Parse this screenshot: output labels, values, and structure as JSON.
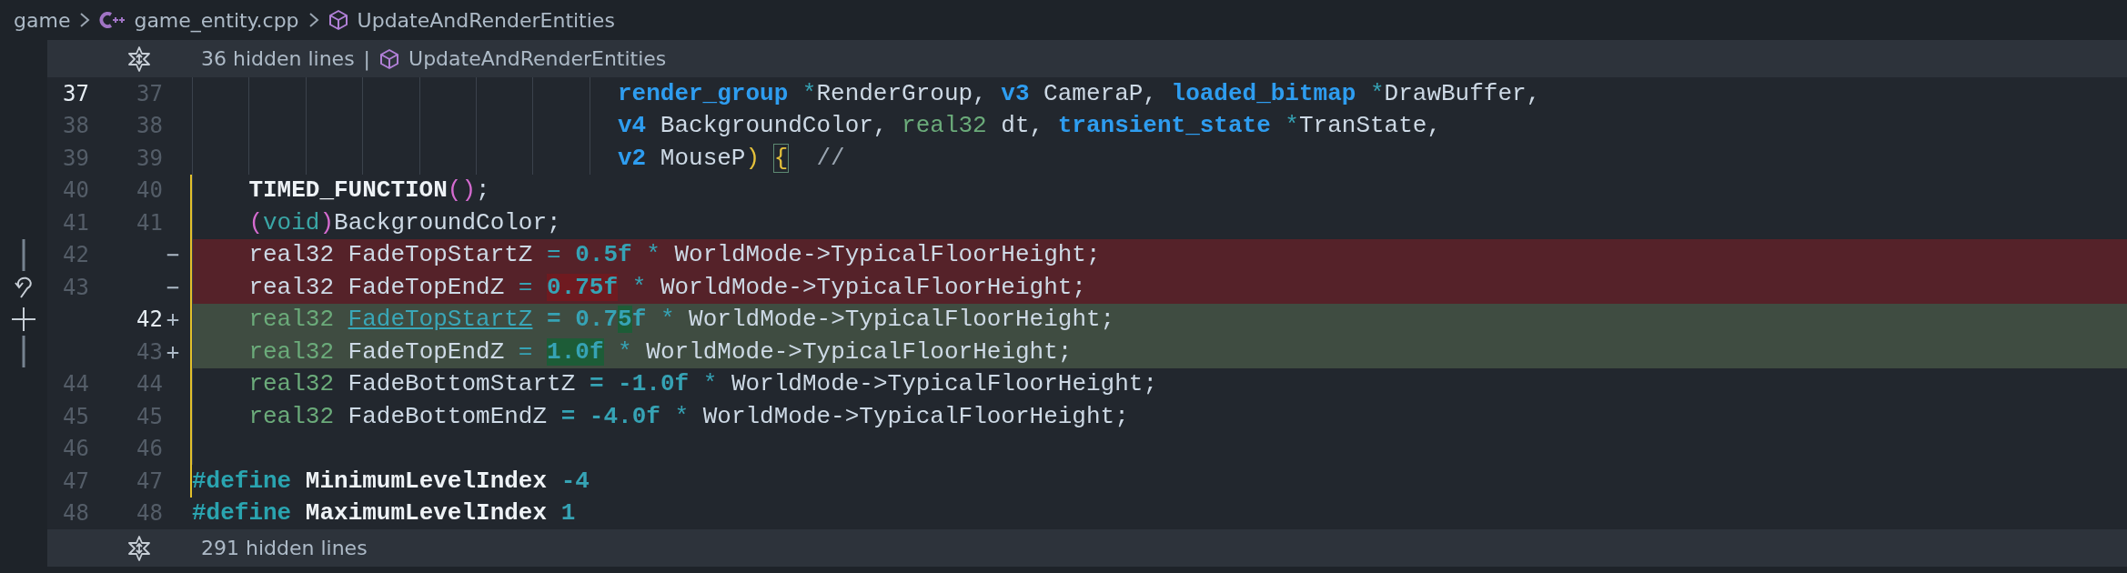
{
  "breadcrumb": {
    "items": [
      {
        "kind": "folder",
        "label": "game"
      },
      {
        "kind": "file",
        "label": "game_entity.cpp"
      },
      {
        "kind": "symbol",
        "label": "UpdateAndRenderEntities"
      }
    ]
  },
  "fold_top": {
    "text": "36 hidden lines",
    "separator": "|",
    "symbol": "UpdateAndRenderEntities"
  },
  "lines": [
    {
      "old": "37",
      "new": "37",
      "kind": "param",
      "current": true,
      "in_scope": false,
      "tokens": [
        {
          "t": "render_group",
          "kind": "kw"
        },
        {
          "t": " *",
          "kind": "op"
        },
        {
          "t": "RenderGroup, ",
          "kind": "plain"
        },
        {
          "t": "v3",
          "kind": "kw"
        },
        {
          "t": " CameraP, ",
          "kind": "plain"
        },
        {
          "t": "loaded_bitmap",
          "kind": "kw"
        },
        {
          "t": " *",
          "kind": "op"
        },
        {
          "t": "DrawBuffer,",
          "kind": "plain"
        }
      ]
    },
    {
      "old": "38",
      "new": "38",
      "kind": "param",
      "current": false,
      "in_scope": false,
      "tokens": [
        {
          "t": "v4",
          "kind": "kw"
        },
        {
          "t": " BackgroundColor, ",
          "kind": "plain"
        },
        {
          "t": "real32",
          "kind": "type"
        },
        {
          "t": " dt, ",
          "kind": "plain"
        },
        {
          "t": "transient_state",
          "kind": "kw"
        },
        {
          "t": " *",
          "kind": "op"
        },
        {
          "t": "TranState,",
          "kind": "plain"
        }
      ]
    },
    {
      "old": "39",
      "new": "39",
      "kind": "param",
      "current": false,
      "in_scope": false,
      "tokens": [
        {
          "t": "v2",
          "kind": "kw"
        },
        {
          "t": " MouseP",
          "kind": "plain"
        },
        {
          "t": ")",
          "kind": "bracket"
        },
        {
          "t": "{",
          "kind": "match"
        },
        {
          "t": "//",
          "kind": "comment"
        }
      ]
    },
    {
      "old": "40",
      "new": "40",
      "kind": "body",
      "current": false,
      "in_scope": true,
      "tokens": [
        {
          "t": "TIMED_FUNCTION",
          "kind": "macro"
        },
        {
          "t": "()",
          "kind": "paren"
        },
        {
          "t": ";",
          "kind": "plain"
        }
      ]
    },
    {
      "old": "41",
      "new": "41",
      "kind": "body",
      "current": false,
      "in_scope": true,
      "tokens": [
        {
          "t": "(",
          "kind": "paren"
        },
        {
          "t": "void",
          "kind": "void"
        },
        {
          "t": ")",
          "kind": "paren"
        },
        {
          "t": "BackgroundColor;",
          "kind": "plain"
        }
      ]
    },
    {
      "old": "42",
      "marker": "−",
      "kind": "removed",
      "current": false,
      "in_scope": true,
      "gutter": {
        "kind": "bar"
      },
      "tokens": [
        {
          "t": "real32 FadeTopStartZ ",
          "kind": "plain"
        },
        {
          "t": "=",
          "kind": "op"
        },
        {
          "t": " 0.5f",
          "kind": "num"
        },
        {
          "t": " *",
          "kind": "op"
        },
        {
          "t": " WorldMode->TypicalFloorHeight;",
          "kind": "plain"
        }
      ]
    },
    {
      "old": "43",
      "marker": "−",
      "kind": "removed",
      "current": false,
      "in_scope": true,
      "gutter": {
        "kind": "revert"
      },
      "tokens": [
        {
          "t": "real32 FadeTopEndZ ",
          "kind": "plain"
        },
        {
          "t": "= ",
          "kind": "op"
        },
        {
          "t": "0.75f",
          "kind": "del"
        },
        {
          "t": " *",
          "kind": "op"
        },
        {
          "t": " WorldMode->TypicalFloorHeight;",
          "kind": "plain"
        }
      ]
    },
    {
      "new": "42",
      "marker": "+",
      "kind": "added",
      "current": true,
      "in_scope": true,
      "gutter": {
        "kind": "add"
      },
      "tokens": [
        {
          "t": "real32 ",
          "kind": "type"
        },
        {
          "t": "FadeTopStartZ",
          "kind": "link"
        },
        {
          "t": " = 0.7",
          "kind": "num"
        },
        {
          "t": "5",
          "kind": "ins"
        },
        {
          "t": "f",
          "kind": "num"
        },
        {
          "t": " *",
          "kind": "op"
        },
        {
          "t": " WorldMode->TypicalFloorHeight;",
          "kind": "plain"
        }
      ]
    },
    {
      "new": "43",
      "marker": "+",
      "kind": "added",
      "current": false,
      "in_scope": true,
      "gutter": {
        "kind": "bar"
      },
      "tokens": [
        {
          "t": "real32",
          "kind": "type"
        },
        {
          "t": " FadeTopEndZ ",
          "kind": "plain"
        },
        {
          "t": "= ",
          "kind": "op"
        },
        {
          "t": "1.0f",
          "kind": "ins"
        },
        {
          "t": " *",
          "kind": "op"
        },
        {
          "t": " WorldMode->TypicalFloorHeight;",
          "kind": "plain"
        }
      ]
    },
    {
      "old": "44",
      "new": "44",
      "kind": "body",
      "current": false,
      "in_scope": true,
      "tokens": [
        {
          "t": "real32",
          "kind": "type"
        },
        {
          "t": " FadeBottomStartZ ",
          "kind": "plain"
        },
        {
          "t": "= -1.0f",
          "kind": "num"
        },
        {
          "t": " *",
          "kind": "op"
        },
        {
          "t": " WorldMode->TypicalFloorHeight;",
          "kind": "plain"
        }
      ]
    },
    {
      "old": "45",
      "new": "45",
      "kind": "body",
      "current": false,
      "in_scope": true,
      "tokens": [
        {
          "t": "real32",
          "kind": "type"
        },
        {
          "t": " FadeBottomEndZ ",
          "kind": "plain"
        },
        {
          "t": "= -4.0f",
          "kind": "num"
        },
        {
          "t": " *",
          "kind": "op"
        },
        {
          "t": " WorldMode->TypicalFloorHeight;",
          "kind": "plain"
        }
      ]
    },
    {
      "old": "46",
      "new": "46",
      "kind": "body",
      "current": false,
      "in_scope": true
    },
    {
      "old": "47",
      "new": "47",
      "kind": "top",
      "current": false,
      "in_scope": true,
      "tokens": [
        {
          "t": "#define",
          "kind": "pre"
        },
        {
          "t": " MinimumLevelIndex",
          "kind": "macro"
        },
        {
          "t": " -4",
          "kind": "num"
        }
      ]
    },
    {
      "old": "48",
      "new": "48",
      "kind": "top",
      "current": false,
      "in_scope": false,
      "tokens": [
        {
          "t": "#define",
          "kind": "pre"
        },
        {
          "t": " MaximumLevelIndex",
          "kind": "macro"
        },
        {
          "t": " 1",
          "kind": "num"
        }
      ]
    }
  ],
  "fold_bottom": {
    "text": "291 hidden lines"
  }
}
